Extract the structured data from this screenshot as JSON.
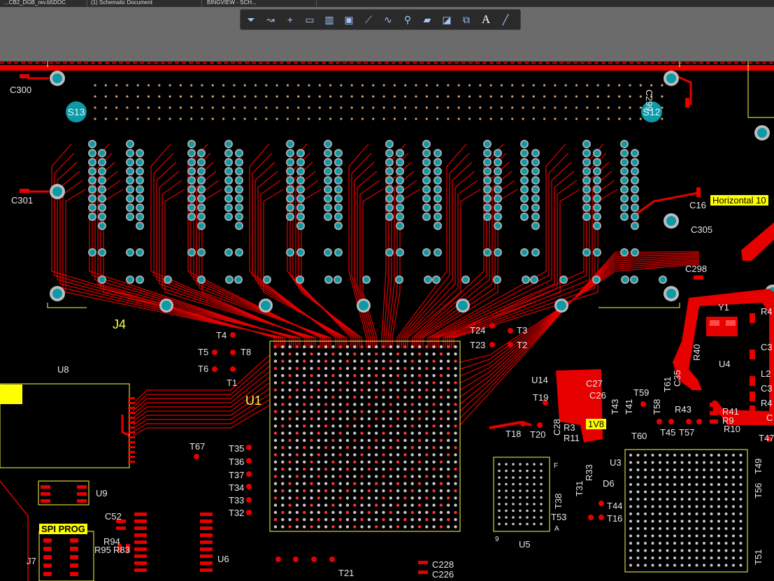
{
  "tabs": [
    {
      "label": "...CB2_DGB_rev.b5DOC"
    },
    {
      "label": "(1) Schematic Document"
    },
    {
      "label": "BINGVIEW - SCH..."
    }
  ],
  "toolbar": {
    "buttons": [
      {
        "icon": "filter-icon",
        "glyph": "⏷"
      },
      {
        "icon": "route-icon",
        "glyph": "↝"
      },
      {
        "icon": "crosshair-icon",
        "glyph": "+"
      },
      {
        "icon": "select-rect-icon",
        "glyph": "▭"
      },
      {
        "icon": "align-icon",
        "glyph": "▥"
      },
      {
        "icon": "component-icon",
        "glyph": "▣"
      },
      {
        "icon": "interactive-route-icon",
        "glyph": "⟋"
      },
      {
        "icon": "diff-pair-icon",
        "glyph": "∿"
      },
      {
        "icon": "via-icon",
        "glyph": "⚲"
      },
      {
        "icon": "polygon-icon",
        "glyph": "▰"
      },
      {
        "icon": "region-icon",
        "glyph": "◪"
      },
      {
        "icon": "dimension-icon",
        "glyph": "⧉"
      },
      {
        "icon": "text-icon",
        "glyph": "A"
      },
      {
        "icon": "line-icon",
        "glyph": "╱"
      }
    ]
  },
  "colors": {
    "board": "#000000",
    "copper": "#e60000",
    "silkscreen": "#ffff4a",
    "pad": "#0b9aa6",
    "text": "#e8e8e8",
    "canvas": "#6b6b6b"
  },
  "silk": {
    "c300": "C300",
    "c301": "C301",
    "c299": "C299",
    "c16": "C16",
    "c305": "C305",
    "c298": "C298",
    "s13": "S13",
    "s12": "S12",
    "j4": "J4",
    "u1": "U1",
    "u8": "U8",
    "u9": "U9",
    "u14": "U14",
    "u4": "U4",
    "u3": "U3",
    "u5": "U5",
    "u6": "U6",
    "j7": "J7",
    "y1": "Y1",
    "t1": "T1",
    "t2": "T2",
    "t3": "T3",
    "t4": "T4",
    "t5": "T5",
    "t6": "T6",
    "t8": "T8",
    "t18": "T18",
    "t19": "T19",
    "t20": "T20",
    "t21": "T21",
    "t23": "T23",
    "t24": "T24",
    "t32": "T32",
    "t33": "T33",
    "t34": "T34",
    "t35": "T35",
    "t36": "T36",
    "t37": "T37",
    "t41": "T41",
    "t43": "T43",
    "t44": "T44",
    "t45": "T45",
    "t47": "T47",
    "t49": "T49",
    "t51": "T51",
    "t53": "T53",
    "t56": "T56",
    "t57": "T57",
    "t58": "T58",
    "t59": "T59",
    "t60": "T60",
    "t61": "T61",
    "t67": "T67",
    "t16": "T16",
    "t38": "T38",
    "t31": "T31",
    "c26": "C26",
    "c27": "C27",
    "c28": "C28",
    "c35": "C35",
    "c52": "C52",
    "c226": "C226",
    "c228": "C228",
    "r3": "R3",
    "r11": "R11",
    "r33": "R33",
    "r40": "R40",
    "r41": "R41",
    "r43": "R43",
    "r9": "R9",
    "r10": "R10",
    "r94": "R94",
    "r95": "R95",
    "r83": "R83",
    "d6": "D6",
    "l2": "L2",
    "c3a": "C3",
    "c3b": "C3",
    "r4a": "R4",
    "r4b": "R4",
    "c_right": "C",
    "pin9": "9",
    "pinA": "A",
    "pinF": "F"
  },
  "badges": {
    "spi_prog": "SPI PROG",
    "net_1v8": "1V8",
    "horizontal": "Horizontal 10"
  }
}
